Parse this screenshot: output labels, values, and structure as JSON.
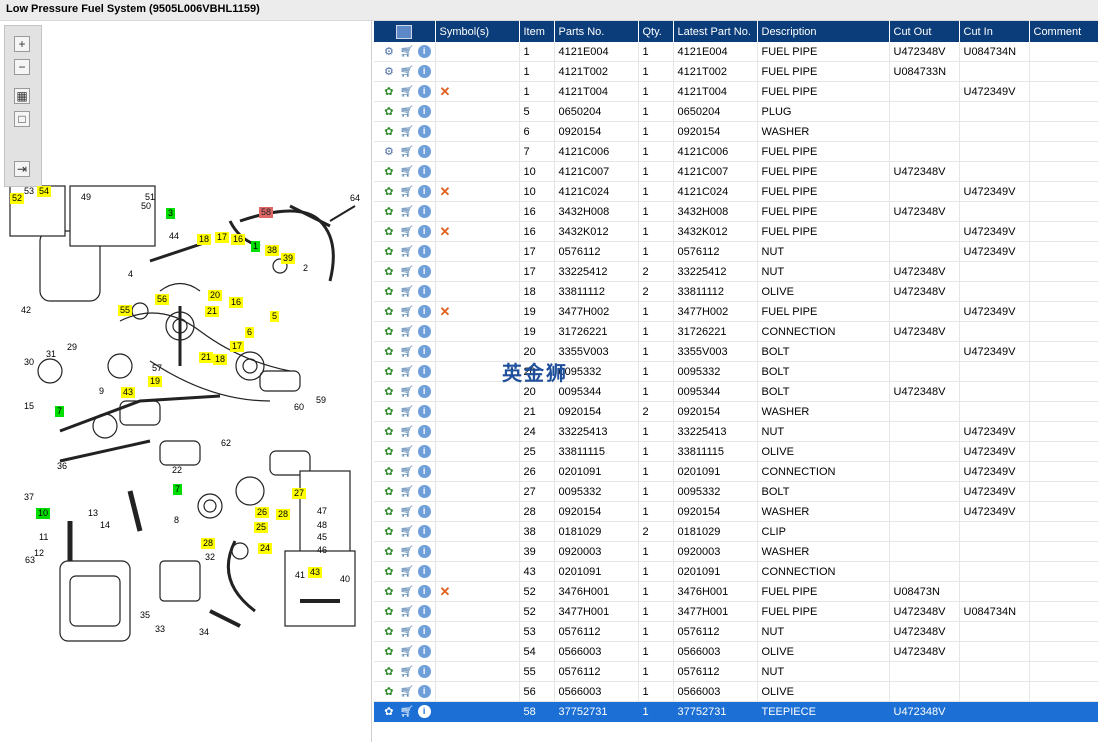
{
  "title": "Low Pressure Fuel System (9505L006VBHL1159)",
  "toolbar": {
    "zoom_in": "zoom-in-icon",
    "zoom_out": "zoom-out-icon",
    "fit": "fit-icon",
    "actual": "actual-size-icon",
    "export": "export-icon"
  },
  "callouts": [
    {
      "label": "53",
      "style": "p"
    },
    {
      "label": "54",
      "style": "y"
    },
    {
      "label": "52",
      "style": "y"
    },
    {
      "label": "49",
      "style": "p"
    },
    {
      "label": "51",
      "style": "p"
    },
    {
      "label": "50",
      "style": "p"
    },
    {
      "label": "3",
      "style": "g"
    },
    {
      "label": "44",
      "style": "p"
    },
    {
      "label": "58",
      "style": "r"
    },
    {
      "label": "64",
      "style": "p"
    },
    {
      "label": "18",
      "style": "y"
    },
    {
      "label": "17",
      "style": "y"
    },
    {
      "label": "16",
      "style": "y"
    },
    {
      "label": "1",
      "style": "g"
    },
    {
      "label": "38",
      "style": "y"
    },
    {
      "label": "39",
      "style": "y"
    },
    {
      "label": "2",
      "style": "p"
    },
    {
      "label": "56",
      "style": "y"
    },
    {
      "label": "20",
      "style": "y"
    },
    {
      "label": "21",
      "style": "y"
    },
    {
      "label": "16",
      "style": "y"
    },
    {
      "label": "5",
      "style": "y"
    },
    {
      "label": "55",
      "style": "y"
    },
    {
      "label": "6",
      "style": "y"
    },
    {
      "label": "42",
      "style": "p"
    },
    {
      "label": "17",
      "style": "y"
    },
    {
      "label": "21",
      "style": "y"
    },
    {
      "label": "18",
      "style": "y"
    },
    {
      "label": "19",
      "style": "y"
    },
    {
      "label": "43",
      "style": "y"
    },
    {
      "label": "7",
      "style": "g"
    },
    {
      "label": "7",
      "style": "g"
    },
    {
      "label": "10",
      "style": "g"
    },
    {
      "label": "27",
      "style": "y"
    },
    {
      "label": "26",
      "style": "y"
    },
    {
      "label": "28",
      "style": "y"
    },
    {
      "label": "25",
      "style": "y"
    },
    {
      "label": "24",
      "style": "y"
    },
    {
      "label": "28",
      "style": "y"
    },
    {
      "label": "43",
      "style": "y"
    },
    {
      "label": "60",
      "style": "p"
    },
    {
      "label": "59",
      "style": "p"
    },
    {
      "label": "62",
      "style": "p"
    },
    {
      "label": "63",
      "style": "p"
    },
    {
      "label": "34",
      "style": "p"
    },
    {
      "label": "33",
      "style": "p"
    },
    {
      "label": "32",
      "style": "p"
    },
    {
      "label": "40",
      "style": "p"
    },
    {
      "label": "41",
      "style": "p"
    },
    {
      "label": "47",
      "style": "p"
    },
    {
      "label": "48",
      "style": "p"
    },
    {
      "label": "45",
      "style": "p"
    },
    {
      "label": "46",
      "style": "p"
    },
    {
      "label": "12",
      "style": "p"
    },
    {
      "label": "11",
      "style": "p"
    },
    {
      "label": "13",
      "style": "p"
    },
    {
      "label": "14",
      "style": "p"
    },
    {
      "label": "15",
      "style": "p"
    },
    {
      "label": "36",
      "style": "p"
    },
    {
      "label": "37",
      "style": "p"
    },
    {
      "label": "30",
      "style": "p"
    },
    {
      "label": "31",
      "style": "p"
    },
    {
      "label": "8",
      "style": "p"
    },
    {
      "label": "9",
      "style": "p"
    },
    {
      "label": "22",
      "style": "p"
    },
    {
      "label": "29",
      "style": "p"
    },
    {
      "label": "4",
      "style": "p"
    },
    {
      "label": "35",
      "style": "p"
    },
    {
      "label": "57",
      "style": "p"
    }
  ],
  "table": {
    "columns": [
      "Symbol(s)",
      "Item",
      "Parts No.",
      "Qty.",
      "Latest Part No.",
      "Description",
      "Cut Out",
      "Cut In",
      "Comment"
    ],
    "rows": [
      {
        "icon": "gears",
        "x": false,
        "item": "1",
        "part": "4121E004",
        "qty": "1",
        "latest": "4121E004",
        "desc": "FUEL PIPE",
        "out": "U472348V",
        "in": "U084734N",
        "comment": ""
      },
      {
        "icon": "gears",
        "x": false,
        "item": "1",
        "part": "4121T002",
        "qty": "1",
        "latest": "4121T002",
        "desc": "FUEL PIPE",
        "out": "U084733N",
        "in": "",
        "comment": ""
      },
      {
        "icon": "gear",
        "x": true,
        "item": "1",
        "part": "4121T004",
        "qty": "1",
        "latest": "4121T004",
        "desc": "FUEL PIPE",
        "out": "",
        "in": "U472349V",
        "comment": ""
      },
      {
        "icon": "gear",
        "x": false,
        "item": "5",
        "part": "0650204",
        "qty": "1",
        "latest": "0650204",
        "desc": "PLUG",
        "out": "",
        "in": "",
        "comment": ""
      },
      {
        "icon": "gear",
        "x": false,
        "item": "6",
        "part": "0920154",
        "qty": "1",
        "latest": "0920154",
        "desc": "WASHER",
        "out": "",
        "in": "",
        "comment": ""
      },
      {
        "icon": "gears",
        "x": false,
        "item": "7",
        "part": "4121C006",
        "qty": "1",
        "latest": "4121C006",
        "desc": "FUEL PIPE",
        "out": "",
        "in": "",
        "comment": ""
      },
      {
        "icon": "gear",
        "x": false,
        "item": "10",
        "part": "4121C007",
        "qty": "1",
        "latest": "4121C007",
        "desc": "FUEL PIPE",
        "out": "U472348V",
        "in": "",
        "comment": ""
      },
      {
        "icon": "gear",
        "x": true,
        "item": "10",
        "part": "4121C024",
        "qty": "1",
        "latest": "4121C024",
        "desc": "FUEL PIPE",
        "out": "",
        "in": "U472349V",
        "comment": ""
      },
      {
        "icon": "gear",
        "x": false,
        "item": "16",
        "part": "3432H008",
        "qty": "1",
        "latest": "3432H008",
        "desc": "FUEL PIPE",
        "out": "U472348V",
        "in": "",
        "comment": ""
      },
      {
        "icon": "gear",
        "x": true,
        "item": "16",
        "part": "3432K012",
        "qty": "1",
        "latest": "3432K012",
        "desc": "FUEL PIPE",
        "out": "",
        "in": "U472349V",
        "comment": ""
      },
      {
        "icon": "gear",
        "x": false,
        "item": "17",
        "part": "0576112",
        "qty": "1",
        "latest": "0576112",
        "desc": "NUT",
        "out": "",
        "in": "U472349V",
        "comment": ""
      },
      {
        "icon": "gear",
        "x": false,
        "item": "17",
        "part": "33225412",
        "qty": "2",
        "latest": "33225412",
        "desc": "NUT",
        "out": "U472348V",
        "in": "",
        "comment": ""
      },
      {
        "icon": "gear",
        "x": false,
        "item": "18",
        "part": "33811112",
        "qty": "2",
        "latest": "33811112",
        "desc": "OLIVE",
        "out": "U472348V",
        "in": "",
        "comment": ""
      },
      {
        "icon": "gear",
        "x": true,
        "item": "19",
        "part": "3477H002",
        "qty": "1",
        "latest": "3477H002",
        "desc": "FUEL PIPE",
        "out": "",
        "in": "U472349V",
        "comment": ""
      },
      {
        "icon": "gear",
        "x": false,
        "item": "19",
        "part": "31726221",
        "qty": "1",
        "latest": "31726221",
        "desc": "CONNECTION",
        "out": "U472348V",
        "in": "",
        "comment": ""
      },
      {
        "icon": "gear",
        "x": false,
        "item": "20",
        "part": "3355V003",
        "qty": "1",
        "latest": "3355V003",
        "desc": "BOLT",
        "out": "",
        "in": "U472349V",
        "comment": ""
      },
      {
        "icon": "gear",
        "x": false,
        "item": "20",
        "part": "0095332",
        "qty": "1",
        "latest": "0095332",
        "desc": "BOLT",
        "out": "",
        "in": "",
        "comment": ""
      },
      {
        "icon": "gear",
        "x": false,
        "item": "20",
        "part": "0095344",
        "qty": "1",
        "latest": "0095344",
        "desc": "BOLT",
        "out": "U472348V",
        "in": "",
        "comment": ""
      },
      {
        "icon": "gear",
        "x": false,
        "item": "21",
        "part": "0920154",
        "qty": "2",
        "latest": "0920154",
        "desc": "WASHER",
        "out": "",
        "in": "",
        "comment": ""
      },
      {
        "icon": "gear",
        "x": false,
        "item": "24",
        "part": "33225413",
        "qty": "1",
        "latest": "33225413",
        "desc": "NUT",
        "out": "",
        "in": "U472349V",
        "comment": ""
      },
      {
        "icon": "gear",
        "x": false,
        "item": "25",
        "part": "33811115",
        "qty": "1",
        "latest": "33811115",
        "desc": "OLIVE",
        "out": "",
        "in": "U472349V",
        "comment": ""
      },
      {
        "icon": "gear",
        "x": false,
        "item": "26",
        "part": "0201091",
        "qty": "1",
        "latest": "0201091",
        "desc": "CONNECTION",
        "out": "",
        "in": "U472349V",
        "comment": ""
      },
      {
        "icon": "gear",
        "x": false,
        "item": "27",
        "part": "0095332",
        "qty": "1",
        "latest": "0095332",
        "desc": "BOLT",
        "out": "",
        "in": "U472349V",
        "comment": ""
      },
      {
        "icon": "gear",
        "x": false,
        "item": "28",
        "part": "0920154",
        "qty": "1",
        "latest": "0920154",
        "desc": "WASHER",
        "out": "",
        "in": "U472349V",
        "comment": ""
      },
      {
        "icon": "gear",
        "x": false,
        "item": "38",
        "part": "0181029",
        "qty": "2",
        "latest": "0181029",
        "desc": "CLIP",
        "out": "",
        "in": "",
        "comment": ""
      },
      {
        "icon": "gear",
        "x": false,
        "item": "39",
        "part": "0920003",
        "qty": "1",
        "latest": "0920003",
        "desc": "WASHER",
        "out": "",
        "in": "",
        "comment": ""
      },
      {
        "icon": "gear",
        "x": false,
        "item": "43",
        "part": "0201091",
        "qty": "1",
        "latest": "0201091",
        "desc": "CONNECTION",
        "out": "",
        "in": "",
        "comment": ""
      },
      {
        "icon": "gear",
        "x": true,
        "item": "52",
        "part": "3476H001",
        "qty": "1",
        "latest": "3476H001",
        "desc": "FUEL PIPE",
        "out": "U08473N",
        "in": "",
        "comment": ""
      },
      {
        "icon": "gear",
        "x": false,
        "item": "52",
        "part": "3477H001",
        "qty": "1",
        "latest": "3477H001",
        "desc": "FUEL PIPE",
        "out": "U472348V",
        "in": "U084734N",
        "comment": ""
      },
      {
        "icon": "gear",
        "x": false,
        "item": "53",
        "part": "0576112",
        "qty": "1",
        "latest": "0576112",
        "desc": "NUT",
        "out": "U472348V",
        "in": "",
        "comment": ""
      },
      {
        "icon": "gear",
        "x": false,
        "item": "54",
        "part": "0566003",
        "qty": "1",
        "latest": "0566003",
        "desc": "OLIVE",
        "out": "U472348V",
        "in": "",
        "comment": ""
      },
      {
        "icon": "gear",
        "x": false,
        "item": "55",
        "part": "0576112",
        "qty": "1",
        "latest": "0576112",
        "desc": "NUT",
        "out": "",
        "in": "",
        "comment": ""
      },
      {
        "icon": "gear",
        "x": false,
        "item": "56",
        "part": "0566003",
        "qty": "1",
        "latest": "0566003",
        "desc": "OLIVE",
        "out": "",
        "in": "",
        "comment": ""
      },
      {
        "icon": "gear",
        "x": false,
        "item": "58",
        "part": "37752731",
        "qty": "1",
        "latest": "37752731",
        "desc": "TEEPIECE",
        "out": "U472348V",
        "in": "",
        "comment": "",
        "selected": true
      }
    ]
  },
  "watermark": "英金狮",
  "colors": {
    "header": "#0b3d7a",
    "selected": "#1c6fd4",
    "yellow": "#ffff00",
    "green": "#00dd00",
    "red": "#e06666"
  }
}
